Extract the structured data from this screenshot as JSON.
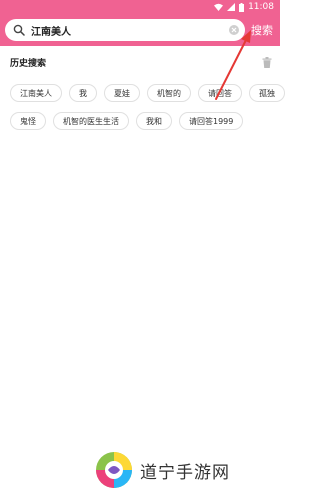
{
  "status_bar": {
    "time": "11:08"
  },
  "search": {
    "query": "江南美人",
    "button_label": "搜索"
  },
  "history": {
    "title": "历史搜索",
    "rows": [
      [
        "江南美人",
        "我",
        "夏娃",
        "机智的",
        "请回答",
        "孤独"
      ],
      [
        "鬼怪",
        "机智的医生生活",
        "我和",
        "请回答1999"
      ]
    ]
  },
  "colors": {
    "accent": "#f06292",
    "annotation_arrow": "#e53935"
  },
  "watermark": {
    "text": "道宁手游网"
  }
}
